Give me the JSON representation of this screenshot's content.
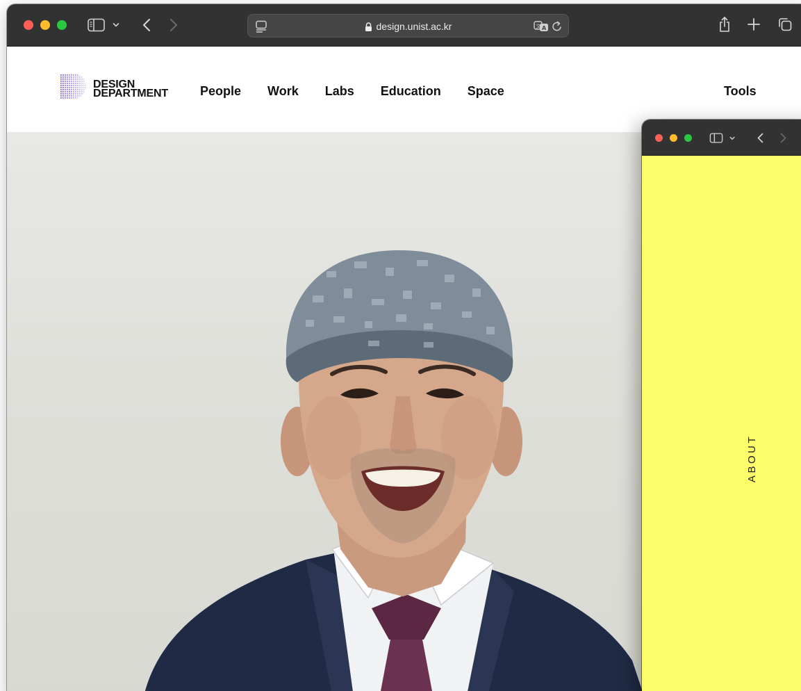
{
  "browser": {
    "url": "design.unist.ac.kr"
  },
  "site": {
    "logo": {
      "line1": "DESIGN",
      "line2": "DEPARTMENT",
      "mark_color": "#7c5cd6"
    },
    "nav": [
      {
        "label": "People"
      },
      {
        "label": "Work"
      },
      {
        "label": "Labs"
      },
      {
        "label": "Education"
      },
      {
        "label": "Space"
      }
    ],
    "tools_label": "Tools"
  },
  "hero": {
    "image": "portrait of smiling man in grey cap, navy suit and purple tie",
    "background_color": "#e3e3df"
  },
  "second_window": {
    "page_color": "#fdfd6a",
    "vertical_label": "ABOUT"
  },
  "colors": {
    "toolbar": "#323232",
    "traffic_red": "#fe5f57",
    "traffic_yellow": "#febc2e",
    "traffic_green": "#28c840"
  }
}
